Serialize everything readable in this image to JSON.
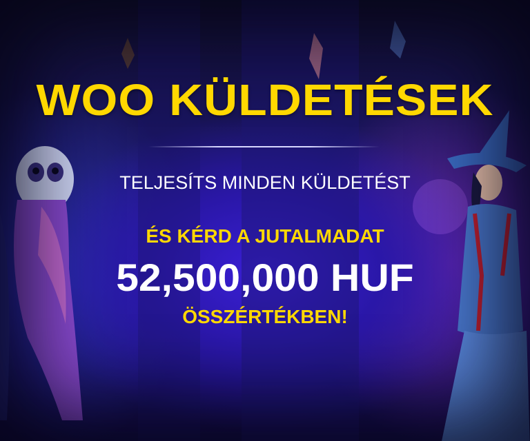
{
  "banner": {
    "title": "WOO KÜLDETÉSEK",
    "subtitle": "TELJESÍTS MINDEN KÜLDETÉST",
    "line_reward": "ÉS KÉRD A JUTALMADAT",
    "amount": "52,500,000 HUF",
    "line_total": "ÖSSZÉRTÉKBEN!"
  },
  "colors": {
    "accent_yellow": "#ffd800",
    "text_white": "#ffffff",
    "background": "#20158a"
  }
}
